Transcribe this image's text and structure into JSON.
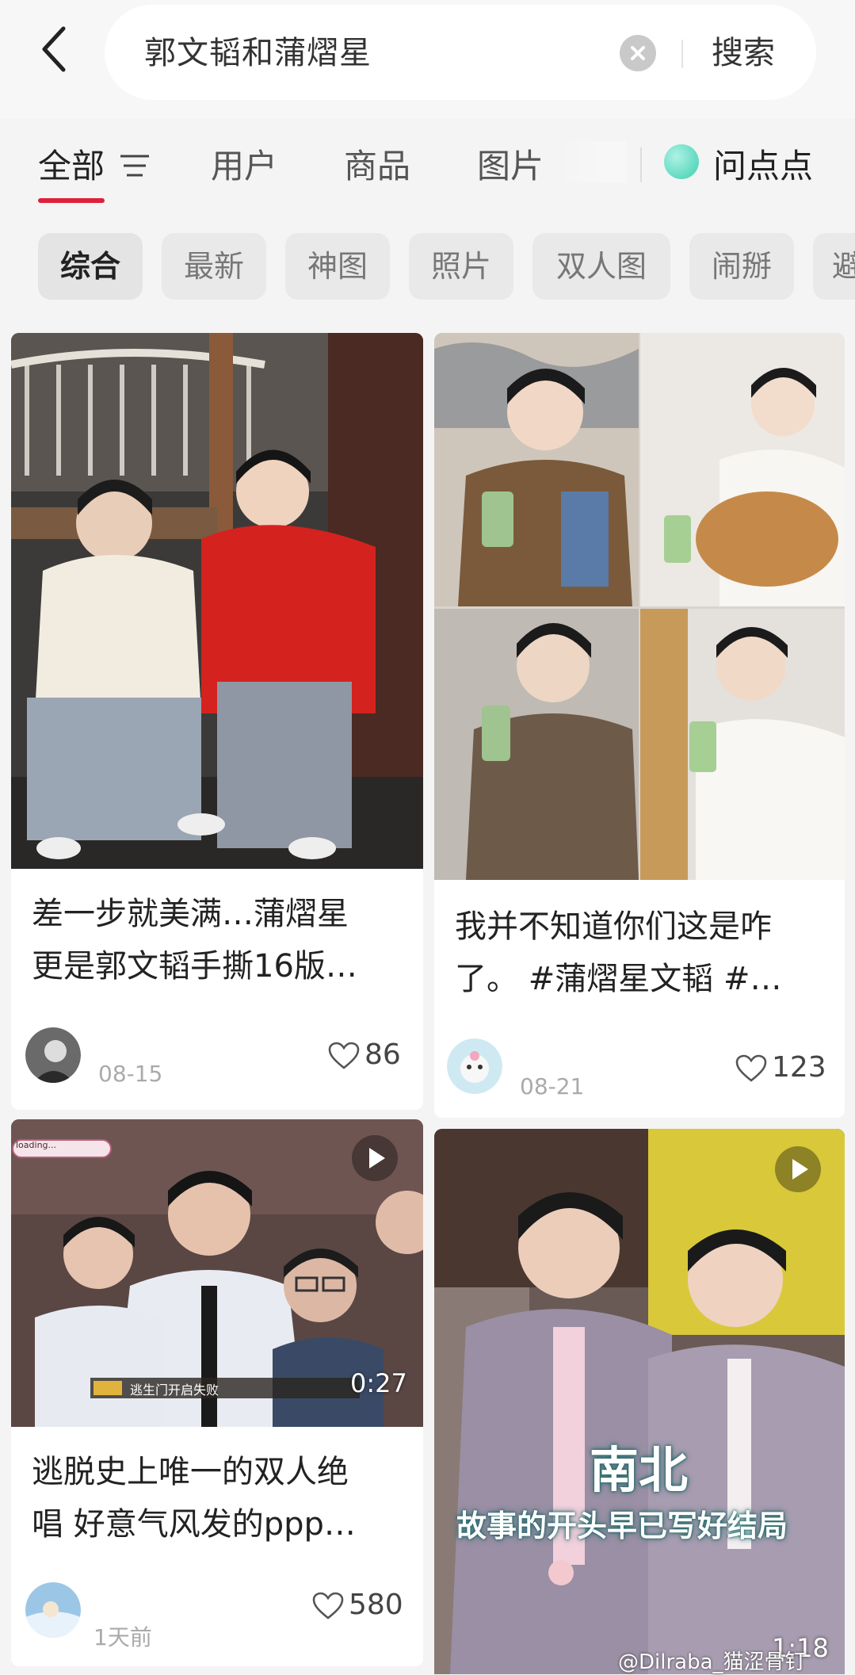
{
  "search": {
    "query": "郭文韬和蒲熠星",
    "button_label": "搜索"
  },
  "tabs": [
    {
      "label": "全部"
    },
    {
      "label": "用户"
    },
    {
      "label": "商品"
    },
    {
      "label": "图片"
    }
  ],
  "ask": {
    "label": "问点点"
  },
  "chips": [
    {
      "label": "综合"
    },
    {
      "label": "最新"
    },
    {
      "label": "神图"
    },
    {
      "label": "照片"
    },
    {
      "label": "双人图"
    },
    {
      "label": "闹掰"
    },
    {
      "label": "避"
    }
  ],
  "cards": [
    {
      "caption_line1": "差一步就美满…蒲熠星",
      "caption_line2": "更是郭文韬手撕16版…",
      "date": "08-15",
      "likes": "86"
    },
    {
      "caption_line1": "我并不知道你们这是咋",
      "caption_line2": "了。 #蒲熠星文韬 #…",
      "date": "08-21",
      "likes": "123"
    },
    {
      "caption_line1": "逃脱史上唯一的双人绝",
      "caption_line2": "唱 好意气风发的ppp…",
      "date": "1天前",
      "likes": "580",
      "duration": "0:27",
      "subtitle": "逃生门开启失败",
      "loading": "loading..."
    },
    {
      "duration": "1:18",
      "overlay_title": "南北",
      "overlay_subtitle": "故事的开头早已写好结局"
    }
  ],
  "watermark": "@Dilraba_猫涩骨钉"
}
